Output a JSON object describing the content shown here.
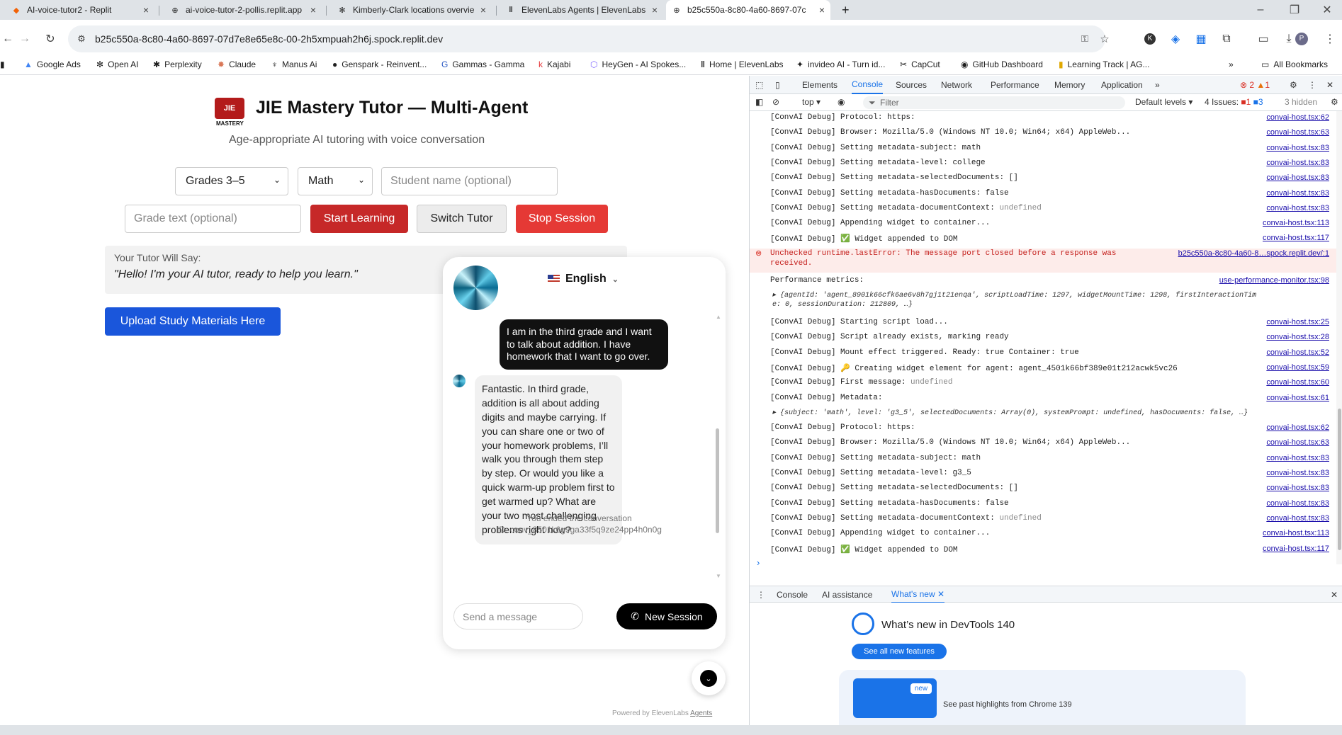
{
  "browser": {
    "tabs": [
      {
        "title": "AI-voice-tutor2 - Replit",
        "icon": "replit-icon"
      },
      {
        "title": "ai-voice-tutor-2-pollis.replit.app",
        "icon": "globe-icon"
      },
      {
        "title": "Kimberly-Clark locations overvie",
        "icon": "openai-icon"
      },
      {
        "title": "ElevenLabs Agents | ElevenLabs",
        "icon": "elevenlabs-icon"
      },
      {
        "title": "b25c550a-8c80-4a60-8697-07c",
        "icon": "globe-icon"
      }
    ],
    "new_tab_label": "+",
    "url": "b25c550a-8c80-4a60-8697-07d7e8e65e8c-00-2h5xmpuah2h6j.spock.replit.dev",
    "bookmarks": [
      {
        "label": "Google Ads",
        "icon": "google-ads-icon"
      },
      {
        "label": "Open AI",
        "icon": "openai-icon"
      },
      {
        "label": "Perplexity",
        "icon": "perplexity-icon"
      },
      {
        "label": "Claude",
        "icon": "claude-icon"
      },
      {
        "label": "Manus Ai",
        "icon": "manus-icon"
      },
      {
        "label": "Genspark - Reinvent...",
        "icon": "genspark-icon"
      },
      {
        "label": "Gammas - Gamma",
        "icon": "gamma-icon"
      },
      {
        "label": "Kajabi",
        "icon": "kajabi-icon"
      },
      {
        "label": "HeyGen - AI Spokes...",
        "icon": "heygen-icon"
      },
      {
        "label": "Home | ElevenLabs",
        "icon": "elevenlabs-icon"
      },
      {
        "label": "invideo AI - Turn id...",
        "icon": "invideo-icon"
      },
      {
        "label": "CapCut",
        "icon": "capcut-icon"
      },
      {
        "label": "GitHub Dashboard",
        "icon": "github-icon"
      },
      {
        "label": "Learning Track | AG...",
        "icon": "learning-icon"
      }
    ],
    "all_bookmarks": "All Bookmarks"
  },
  "app": {
    "logo_text": "JIE",
    "logo_sub": "MASTERY",
    "title": "JIE Mastery Tutor — Multi-Agent",
    "subtitle": "Age-appropriate AI tutoring with voice conversation",
    "grade_select": "Grades 3–5",
    "subject_select": "Math",
    "student_name_placeholder": "Student name (optional)",
    "grade_text_placeholder": "Grade text (optional)",
    "start_button": "Start Learning",
    "switch_button": "Switch Tutor",
    "stop_button": "Stop Session",
    "tutor_say_label": "Your Tutor Will Say:",
    "tutor_say_text": "\"Hello! I'm your AI tutor, ready to help you learn.\"",
    "upload_button": "Upload Study Materials Here",
    "colors": {
      "start": "#c62828",
      "stop": "#e53935",
      "upload": "#1a56db"
    }
  },
  "widget": {
    "language": "English",
    "user_message": "I am in the third grade and I want to talk about addition. I have homework that I want to go over.",
    "agent_message": "Fantastic. In third grade, addition is all about adding digits and maybe carrying. If you can share one or two of your homework problems, I’ll walk you through them step by step. Or would you like a quick warm-up problem first to get warmed up? What are your two most challenging problems right now?",
    "ended_text": "You ended the conversation",
    "conversation_id": "ID: conv_8501k6g9ga33f5q9ze24pp4h0n0g",
    "message_placeholder": "Send a message",
    "new_session_button": "New Session",
    "powered_by": "Powered by ElevenLabs",
    "powered_link": "Agents"
  },
  "devtools": {
    "tabs": [
      "Elements",
      "Console",
      "Sources",
      "Network",
      "Performance",
      "Memory",
      "Application"
    ],
    "more_tabs": "»",
    "error_count": "2",
    "warn_count": "1",
    "context": "top",
    "filter_placeholder": "Filter",
    "levels": "Default levels",
    "issues": "4 Issues:",
    "issues_err": "1",
    "issues_warn": "3",
    "hidden": "3 hidden",
    "drawer_tabs": [
      "Console",
      "AI assistance",
      "What's new"
    ],
    "whats_new_title": "What’s new in DevTools 140",
    "see_all": "See all new features",
    "new_badge": "new",
    "past_highlights": "See past highlights from Chrome 139",
    "prompt": "›",
    "logs": [
      {
        "text": "[ConvAI Debug] Protocol: https:",
        "src": "convai-host.tsx:62"
      },
      {
        "text": "[ConvAI Debug] Browser: Mozilla/5.0 (Windows NT 10.0; Win64; x64) AppleWeb...",
        "src": "convai-host.tsx:63"
      },
      {
        "text": "[ConvAI Debug] Setting metadata-subject: math",
        "src": "convai-host.tsx:83"
      },
      {
        "text": "[ConvAI Debug] Setting metadata-level: college",
        "src": "convai-host.tsx:83"
      },
      {
        "text": "[ConvAI Debug] Setting metadata-selectedDocuments: []",
        "src": "convai-host.tsx:83"
      },
      {
        "text": "[ConvAI Debug] Setting metadata-hasDocuments: false",
        "src": "convai-host.tsx:83"
      },
      {
        "text": "[ConvAI Debug] Setting metadata-documentContext: ",
        "extra": "undefined",
        "src": "convai-host.tsx:83"
      },
      {
        "text": "[ConvAI Debug] Appending widget to container...",
        "src": "convai-host.tsx:113"
      },
      {
        "text": "[ConvAI Debug] ✅ Widget appended to DOM",
        "src": "convai-host.tsx:117"
      },
      {
        "text": "Unchecked runtime.lastError: The message port closed before a response was",
        "text2": "received.",
        "src": "b25c550a-8c80-4a60-8…spock.replit.dev/:1",
        "type": "error"
      },
      {
        "text": "Performance metrics:",
        "src": "use-performance-monitor.tsx:98"
      },
      {
        "text": "▸ {agentId: 'agent_8901k66cfk6ae6v8h7gj1t21enqa', scriptLoadTime: 1297, widgetMountTime: 1298, firstInteractionTim",
        "text2": "  e: 0, sessionDuration: 212809, …}",
        "type": "obj"
      },
      {
        "text": "[ConvAI Debug] Starting script load...",
        "src": "convai-host.tsx:25"
      },
      {
        "text": "[ConvAI Debug] Script already exists, marking ready",
        "src": "convai-host.tsx:28"
      },
      {
        "text": "[ConvAI Debug] Mount effect triggered. Ready: true Container: true",
        "src": "convai-host.tsx:52"
      },
      {
        "text": "[ConvAI Debug] 🔑 Creating widget element for agent: agent_4501k66bf389e01t212acwk5vc26",
        "src": "convai-host.tsx:59"
      },
      {
        "text": "[ConvAI Debug] First message: ",
        "extra": "undefined",
        "src": "convai-host.tsx:60"
      },
      {
        "text": "[ConvAI Debug] Metadata:",
        "src": "convai-host.tsx:61"
      },
      {
        "text": "▸ {subject: 'math', level: 'g3_5', selectedDocuments: Array(0), systemPrompt: undefined, hasDocuments: false, …}",
        "type": "obj"
      },
      {
        "text": "[ConvAI Debug] Protocol: https:",
        "src": "convai-host.tsx:62"
      },
      {
        "text": "[ConvAI Debug] Browser: Mozilla/5.0 (Windows NT 10.0; Win64; x64) AppleWeb...",
        "src": "convai-host.tsx:63"
      },
      {
        "text": "[ConvAI Debug] Setting metadata-subject: math",
        "src": "convai-host.tsx:83"
      },
      {
        "text": "[ConvAI Debug] Setting metadata-level: g3_5",
        "src": "convai-host.tsx:83"
      },
      {
        "text": "[ConvAI Debug] Setting metadata-selectedDocuments: []",
        "src": "convai-host.tsx:83"
      },
      {
        "text": "[ConvAI Debug] Setting metadata-hasDocuments: false",
        "src": "convai-host.tsx:83"
      },
      {
        "text": "[ConvAI Debug] Setting metadata-documentContext: ",
        "extra": "undefined",
        "src": "convai-host.tsx:83"
      },
      {
        "text": "[ConvAI Debug] Appending widget to container...",
        "src": "convai-host.tsx:113"
      },
      {
        "text": "[ConvAI Debug] ✅ Widget appended to DOM",
        "src": "convai-host.tsx:117"
      }
    ]
  }
}
